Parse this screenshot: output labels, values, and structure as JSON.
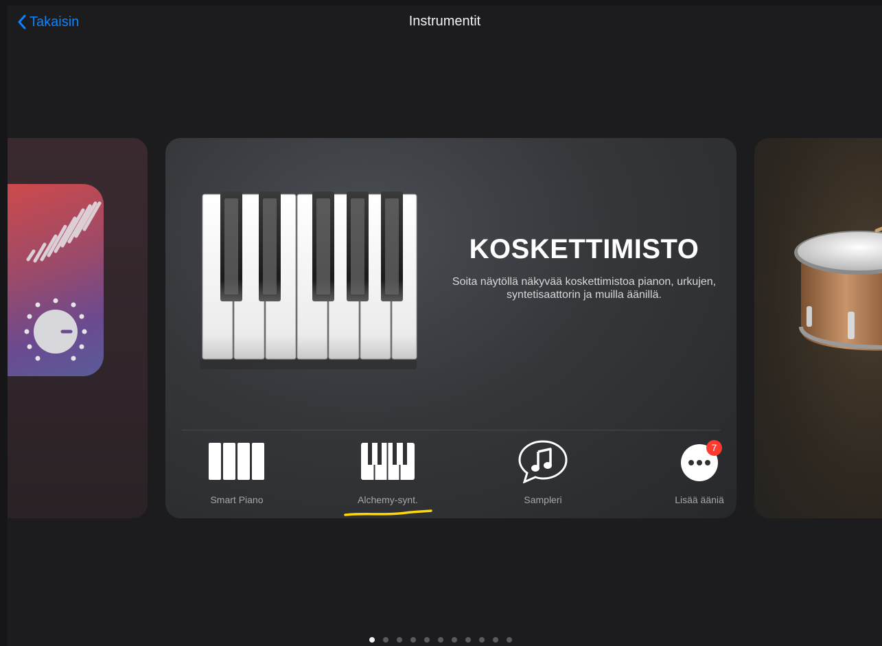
{
  "nav": {
    "back_label": "Takaisin",
    "title": "Instrumentit"
  },
  "card": {
    "title": "KOSKETTIMISTO",
    "description": "Soita näytöllä näkyvää koskettimistoa pianon, urkujen, syntetisaattorin ja muilla äänillä."
  },
  "options": [
    {
      "label": "Smart Piano",
      "icon": "smart-piano-icon"
    },
    {
      "label": "Alchemy-synt.",
      "icon": "alchemy-synth-icon"
    },
    {
      "label": "Sampleri",
      "icon": "sampler-icon"
    },
    {
      "label": "Lisää ääniä",
      "icon": "more-sounds-icon",
      "badge": "7"
    }
  ],
  "pager": {
    "total": 11,
    "current": 1
  },
  "colors": {
    "accent": "#0a84ff",
    "badge": "#ff3b30",
    "highlight": "#ffd60a"
  }
}
